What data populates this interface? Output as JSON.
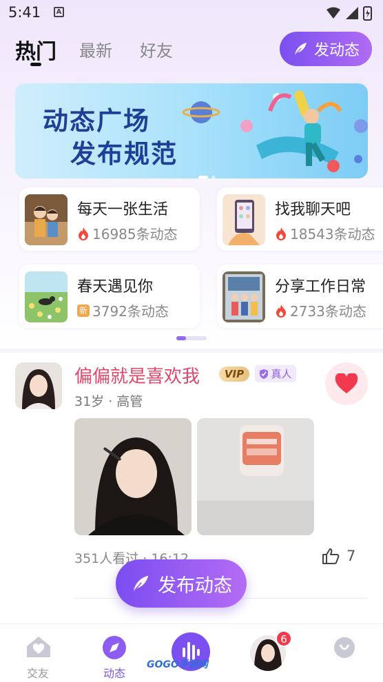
{
  "status_bar": {
    "time": "5:41",
    "notif_letter": "A"
  },
  "tabs": [
    {
      "label": "热门",
      "active": true
    },
    {
      "label": "最新",
      "active": false
    },
    {
      "label": "好友",
      "active": false
    }
  ],
  "top_post_button": {
    "label": "发动态"
  },
  "banner": {
    "line1": "动态广场",
    "line2": "发布规范"
  },
  "topics": [
    {
      "name": "每天一张生活",
      "count": "16985条动态",
      "icon": "fire-icon"
    },
    {
      "name": "找我聊天吧",
      "count": "18543条动态",
      "icon": "fire-icon"
    },
    {
      "name": "春天遇见你",
      "count": "3792条动态",
      "icon": "new-icon",
      "icon_text": "新"
    },
    {
      "name": "分享工作日常",
      "count": "2733条动态",
      "icon": "fire-icon"
    }
  ],
  "post": {
    "user_name": "偏偏就是喜欢我",
    "vip_label": "VIP",
    "real_label": "真人",
    "meta": "31岁 · 高管",
    "views": "351人看过 · 16:12",
    "likes": "7"
  },
  "fab": {
    "label": "发布动态"
  },
  "bottom_nav": [
    {
      "label": "交友",
      "active": false
    },
    {
      "label": "动态",
      "active": true
    }
  ],
  "message_badge": "6",
  "watermark": "GOGO手游网",
  "colors": {
    "accent": "#7c53e8",
    "name_pink": "#e0476a",
    "fire": "#f04a3c"
  }
}
